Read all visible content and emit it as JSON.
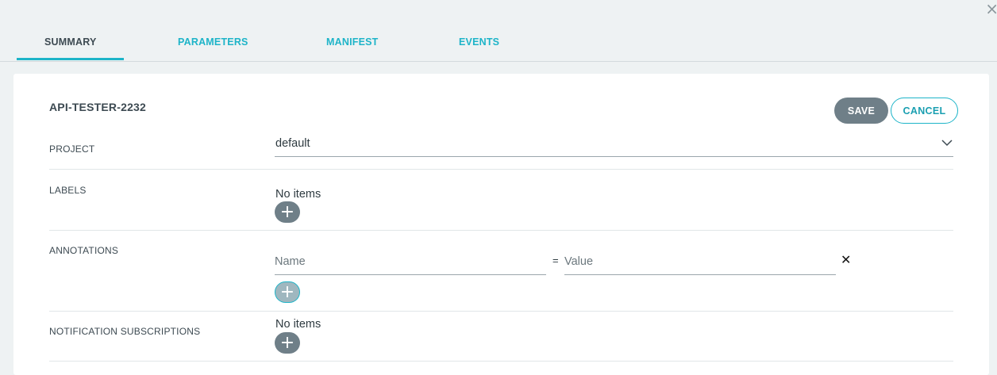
{
  "dialog": {
    "close_glyph": "×",
    "close_icon": "close-icon"
  },
  "tabs": [
    {
      "label": "SUMMARY",
      "active": true
    },
    {
      "label": "PARAMETERS",
      "active": false
    },
    {
      "label": "MANIFEST",
      "active": false
    },
    {
      "label": "EVENTS",
      "active": false
    }
  ],
  "app": {
    "name": "API-TESTER-2232"
  },
  "actions": {
    "save_label": "SAVE",
    "cancel_label": "CANCEL"
  },
  "project": {
    "label": "PROJECT",
    "value": "default",
    "icon": "chevron-down-icon"
  },
  "labels": {
    "label": "LABELS",
    "empty_text": "No items",
    "add_glyph": "+"
  },
  "annotations": {
    "label": "ANNOTATIONS",
    "name_placeholder": "Name",
    "value_placeholder": "Value",
    "separator": "=",
    "remove_glyph": "✕",
    "add_glyph": "+"
  },
  "notifications": {
    "label": "NOTIFICATION SUBSCRIPTIONS",
    "empty_text": "No items",
    "add_glyph": "+"
  },
  "colors": {
    "accent": "#1db4c8",
    "button_gray": "#6f7f88",
    "text": "#3d4a52",
    "background": "#eef2f3"
  }
}
